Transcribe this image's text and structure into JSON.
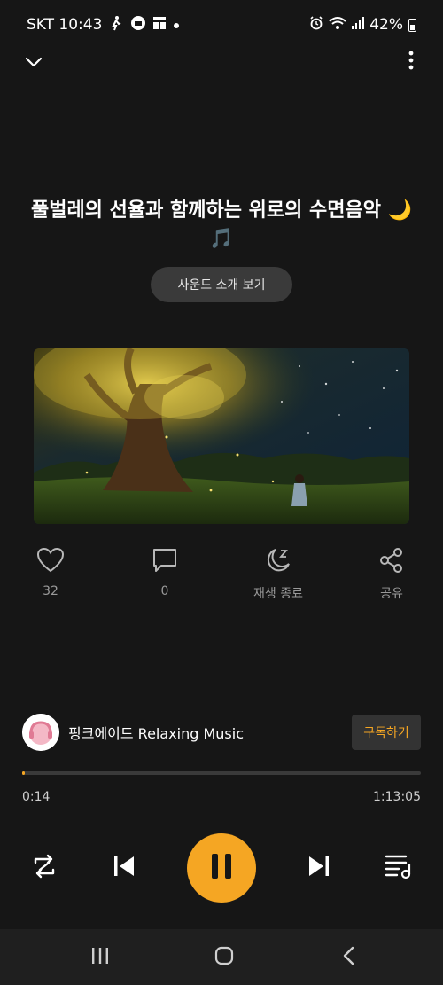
{
  "status_bar": {
    "carrier_time": "SKT 10:43",
    "battery": "42%",
    "icons": [
      "figure-icon",
      "lock-app-icon",
      "grid-app-icon",
      "dot-icon",
      "alarm-icon",
      "wifi-icon",
      "signal-icon",
      "battery-icon"
    ]
  },
  "header": {
    "collapse_icon": "chevron-down-icon",
    "more_icon": "more-vertical-icon"
  },
  "track": {
    "title": "풀벌레의 선율과 함께하는 위로의 수면음악 🌙🎵",
    "intro_button": "사운드 소개 보기"
  },
  "actions": [
    {
      "icon": "heart-icon",
      "label": "32"
    },
    {
      "icon": "comment-icon",
      "label": "0"
    },
    {
      "icon": "sleep-timer-icon",
      "label": "재생 종료"
    },
    {
      "icon": "share-icon",
      "label": "공유"
    }
  ],
  "channel": {
    "name": "핑크에이드 Relaxing Music",
    "subscribe_label": "구독하기"
  },
  "player": {
    "current_time": "0:14",
    "total_time": "1:13:05",
    "progress_fraction": 0.003
  },
  "colors": {
    "accent": "#f5a623",
    "background": "#161616"
  }
}
